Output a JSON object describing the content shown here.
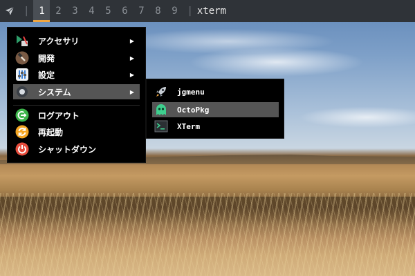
{
  "panel": {
    "separator_left": "|",
    "separator_right": "|",
    "workspaces": [
      "1",
      "2",
      "3",
      "4",
      "5",
      "6",
      "7",
      "8",
      "9"
    ],
    "active_workspace": "1",
    "window_title": "xterm"
  },
  "main_menu": {
    "items": [
      {
        "label": "アクセサリ",
        "icon": "accessories-icon",
        "has_submenu": true
      },
      {
        "label": "開発",
        "icon": "hammer-icon",
        "has_submenu": true
      },
      {
        "label": "設定",
        "icon": "settings-icon",
        "has_submenu": true
      },
      {
        "label": "システム",
        "icon": "system-icon",
        "has_submenu": true,
        "selected": true
      },
      {
        "label": "ログアウト",
        "icon": "logout-icon",
        "has_submenu": false
      },
      {
        "label": "再起動",
        "icon": "reboot-icon",
        "has_submenu": false
      },
      {
        "label": "シャットダウン",
        "icon": "power-icon",
        "has_submenu": false
      }
    ],
    "arrow": "▶"
  },
  "submenu": {
    "items": [
      {
        "label": "jgmenu",
        "icon": "rocket-icon"
      },
      {
        "label": "OctoPkg",
        "icon": "octopkg-ghost-icon",
        "selected": true
      },
      {
        "label": "XTerm",
        "icon": "terminal-icon"
      }
    ]
  },
  "colors": {
    "panel_bg": "#2f3338",
    "active_ws_underline": "#f0a640",
    "menu_bg": "#000000",
    "menu_selected": "#555555",
    "logout_green": "#3cb44a",
    "reboot_orange": "#f5a623",
    "power_red": "#e74c3c"
  }
}
